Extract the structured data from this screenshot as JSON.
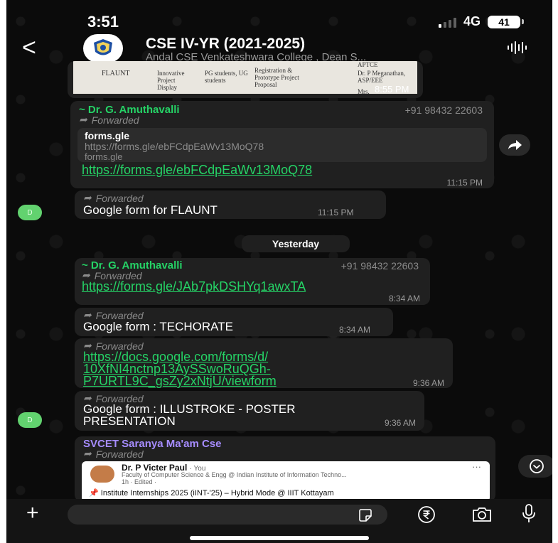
{
  "status": {
    "time": "3:51",
    "network": "4G",
    "battery": "41"
  },
  "header": {
    "title": "CSE IV-YR (2021-2025)",
    "subtitle": "Andal CSE Venkateshwara College , Dean S..."
  },
  "image_doc": {
    "col1": "FLAUNT",
    "col2": "Innovative Project Display",
    "col3": "PG students, UG students",
    "col4": "Registration & Prototype Project Proposal",
    "col5": "Dr. P Meganathan, ASP/EEE",
    "top_right": "APTCE",
    "bottom_right": "Mrs.",
    "time": "8:55 PM"
  },
  "messages": [
    {
      "sender": "~ Dr. G. Amuthavalli",
      "phone": "+91 98432 22603",
      "forwarded": "Forwarded",
      "preview_title": "forms.gle",
      "preview_url": "https://forms.gle/ebFCdpEaWv13MoQ78",
      "preview_domain": "forms.gle",
      "link": "https://forms.gle/ebFCdpEaWv13MoQ78",
      "time": "11:15 PM"
    },
    {
      "avatar": "D",
      "forwarded": "Forwarded",
      "text": "Google form for FLAUNT",
      "time": "11:15 PM"
    },
    {
      "sender": "~ Dr. G. Amuthavalli",
      "phone": "+91 98432 22603",
      "forwarded": "Forwarded",
      "link": "https://forms.gle/JAb7pkDSHYq1awxTA",
      "time": "8:34 AM"
    },
    {
      "forwarded": "Forwarded",
      "text": "Google form : TECHORATE",
      "time": "8:34 AM"
    },
    {
      "forwarded": "Forwarded",
      "link_lines": [
        "https://docs.google.com/forms/d/",
        "10XfNI4nctnp13AySSwoRuQGh-",
        "P7URTL9C_gsZy2xNtjU/viewform"
      ],
      "time": "9:36 AM"
    },
    {
      "avatar": "D",
      "forwarded": "Forwarded",
      "text_lines": [
        "Google form : ILLUSTROKE - POSTER",
        "PRESENTATION"
      ],
      "time": "9:36 AM"
    },
    {
      "sender": "SVCET Saranya Ma'am Cse",
      "forwarded": "Forwarded",
      "card_name": "Dr. P Victer Paul",
      "card_you": "· You",
      "card_headline": "Faculty of Computer Science & Engg @ Indian Institute of Information Techno...",
      "card_meta": "1h · Edited ·",
      "card_text": "Institute Internships 2025 (iINT-'25) – Hybrid Mode @ IIIT Kottayam",
      "card_more": "···"
    }
  ],
  "date_divider": "Yesterday",
  "input": {
    "placeholder": ""
  },
  "icons": [
    "back-icon",
    "group-logo-icon",
    "voice-call-icon",
    "share-icon",
    "scroll-down-icon",
    "plus-icon",
    "sticker-icon",
    "rupee-icon",
    "camera-icon",
    "mic-icon",
    "forwarded-icon"
  ],
  "colors": {
    "accent": "#25d366",
    "bubble": "#202020",
    "background": "#0b0b0b",
    "sender_purple": "#a68cff"
  }
}
